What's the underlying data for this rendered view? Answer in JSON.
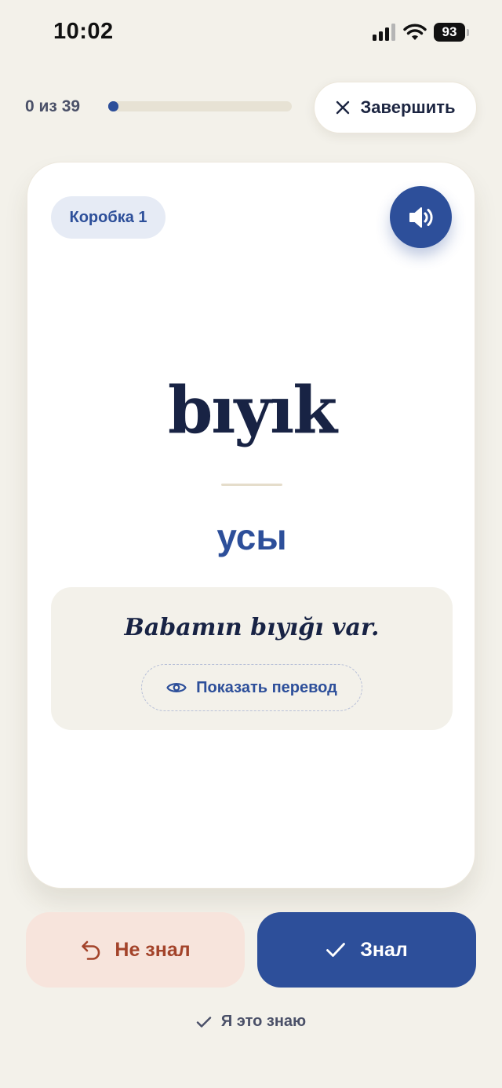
{
  "status_bar": {
    "time": "10:02",
    "battery": "93"
  },
  "progress": {
    "label": "0 из 39",
    "current": 0,
    "total": 39
  },
  "header": {
    "finish_label": "Завершить"
  },
  "card": {
    "box_label": "Коробка 1",
    "term": "bıyık",
    "translation": "усы",
    "example_sentence": "Babamın bıyığı var.",
    "show_translation_label": "Показать перевод"
  },
  "actions": {
    "unknown_label": "Не знал",
    "known_label": "Знал",
    "already_know_label": "Я это знаю"
  },
  "colors": {
    "accent": "#2d4f9a",
    "background": "#f3f1ea",
    "unknown_bg": "#f7e4dc",
    "unknown_text": "#a3432a"
  },
  "icons": {
    "close": "close-icon",
    "sound": "speaker-icon",
    "eye": "eye-icon",
    "undo": "undo-icon",
    "check": "check-icon"
  }
}
